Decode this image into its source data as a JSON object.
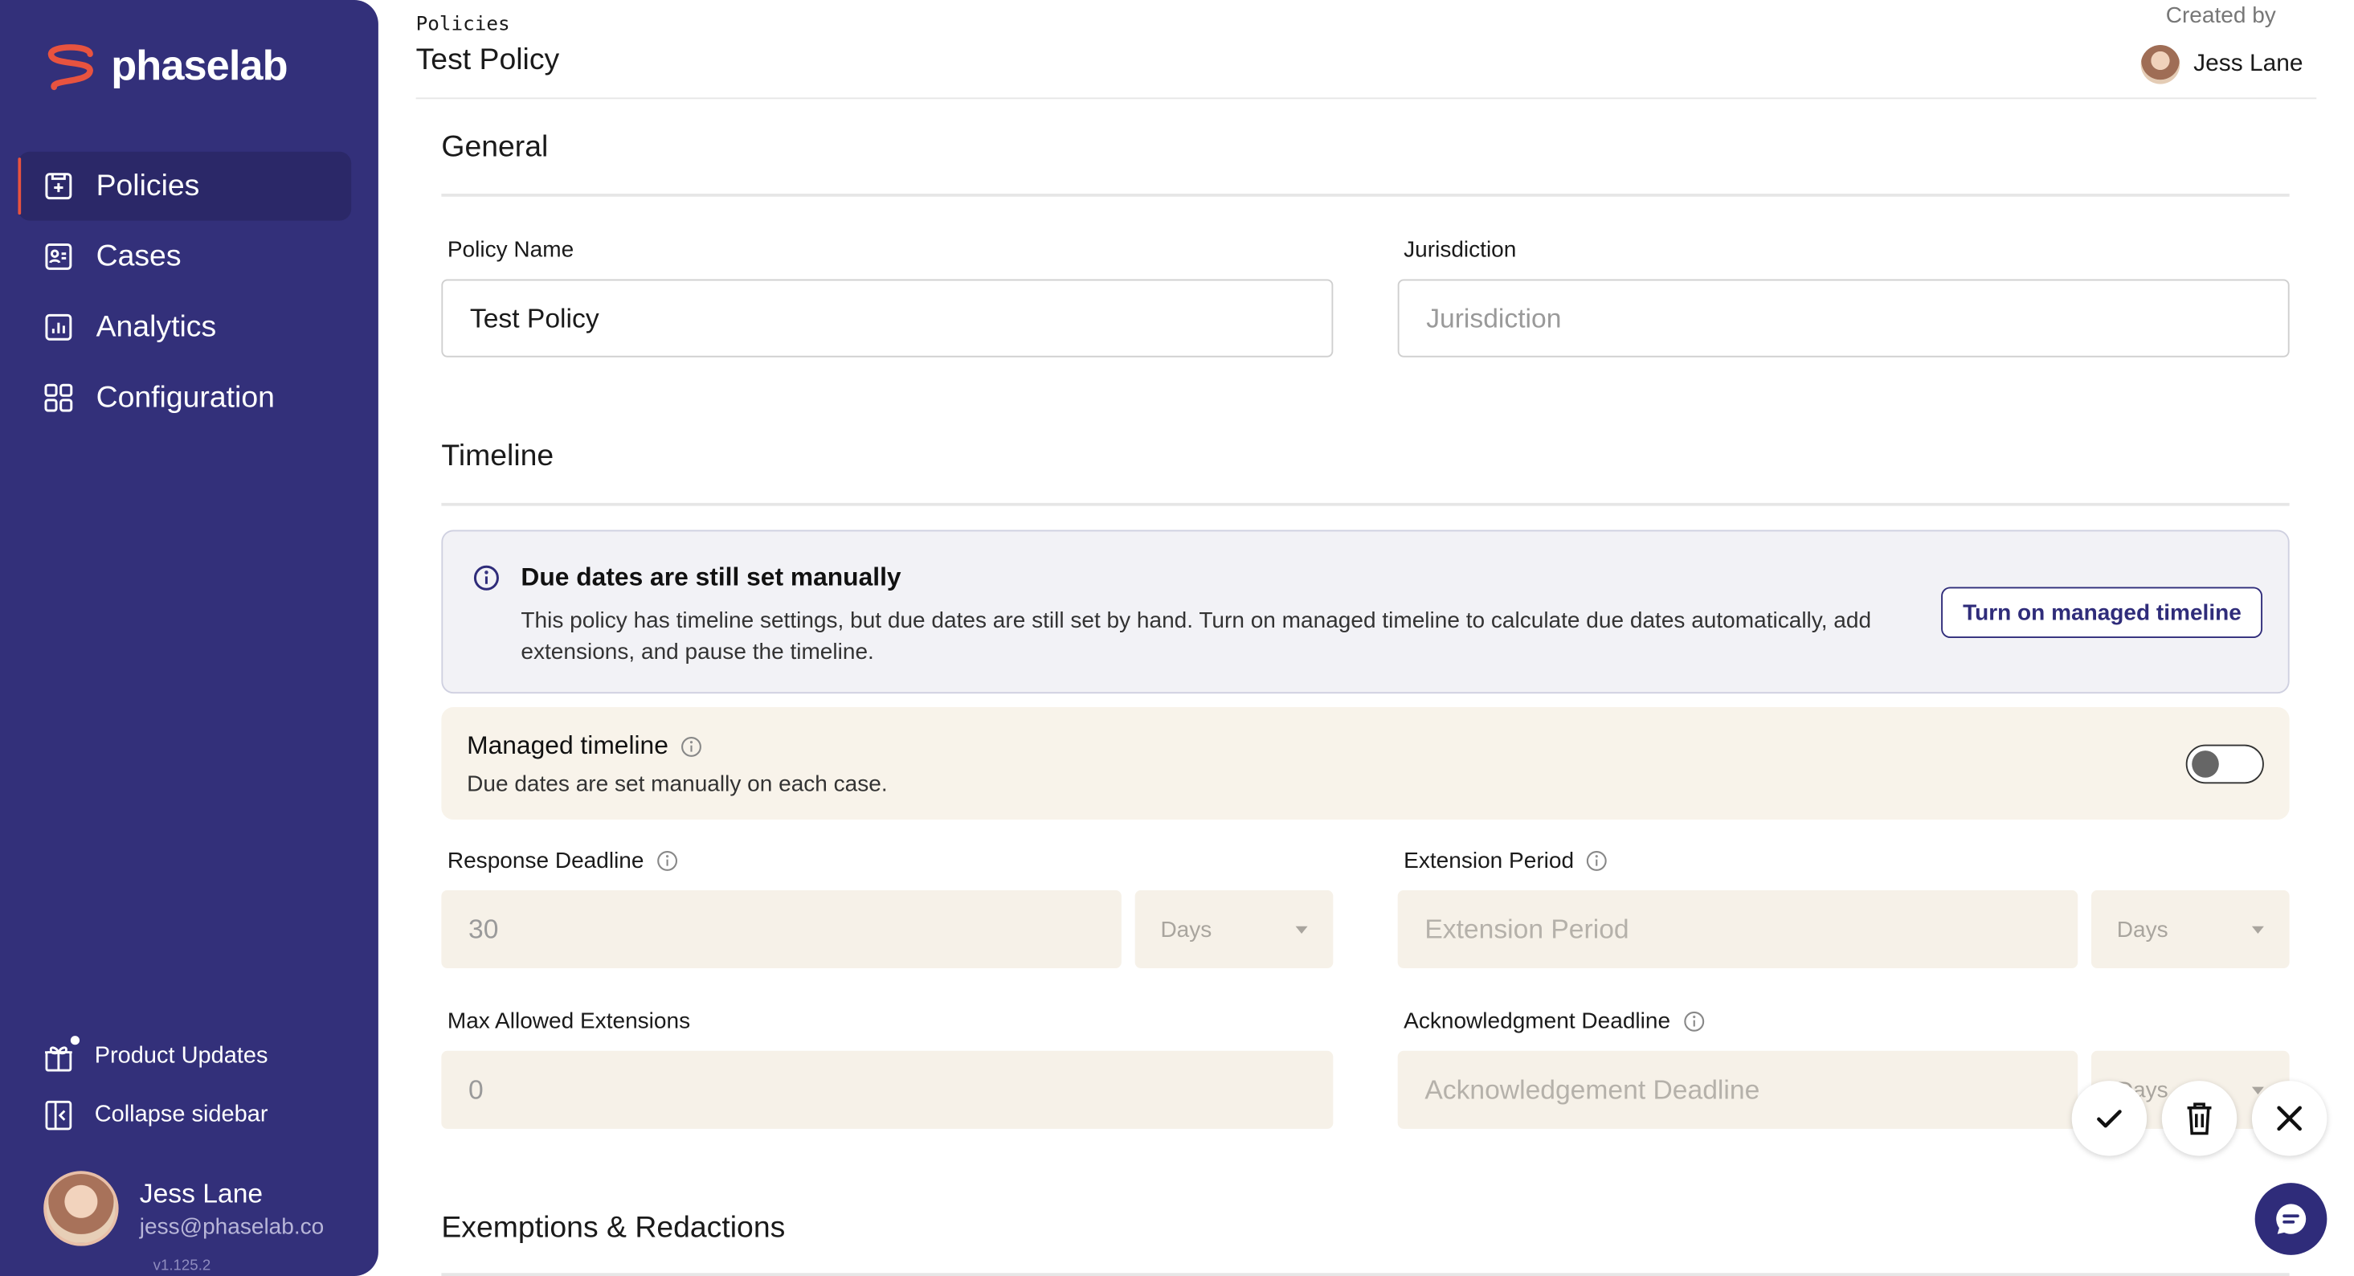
{
  "app": {
    "brand": "phaselab",
    "version": "v1.125.2"
  },
  "colors": {
    "sidebar": "#33307a",
    "accent": "#e8533f",
    "primary": "#2f2c7a",
    "disabled_field": "#f6f1e8"
  },
  "sidebar": {
    "items": [
      {
        "label": "Policies",
        "icon": "policy-doc-icon",
        "active": true
      },
      {
        "label": "Cases",
        "icon": "cases-card-icon",
        "active": false
      },
      {
        "label": "Analytics",
        "icon": "analytics-chart-icon",
        "active": false
      },
      {
        "label": "Configuration",
        "icon": "grid-config-icon",
        "active": false
      }
    ],
    "product_updates": "Product Updates",
    "collapse": "Collapse sidebar",
    "user": {
      "name": "Jess Lane",
      "email": "jess@phaselab.co"
    }
  },
  "header": {
    "breadcrumb": "Policies",
    "title": "Test Policy",
    "created_by_label": "Created by",
    "created_by_name": "Jess Lane"
  },
  "general": {
    "title": "General",
    "policy_name": {
      "label": "Policy Name",
      "value": "Test Policy"
    },
    "jurisdiction": {
      "label": "Jurisdiction",
      "value": "",
      "placeholder": "Jurisdiction"
    }
  },
  "timeline": {
    "title": "Timeline",
    "alert": {
      "title": "Due dates are still set manually",
      "body": "This policy has timeline settings, but due dates are still set by hand. Turn on managed timeline to calculate due dates automatically, add extensions, and pause the timeline.",
      "button": "Turn on managed timeline"
    },
    "managed": {
      "title": "Managed timeline",
      "description": "Due dates are set manually on each case.",
      "enabled": false
    },
    "response_deadline": {
      "label": "Response Deadline",
      "value": "30",
      "unit": "Days"
    },
    "extension_period": {
      "label": "Extension Period",
      "placeholder": "Extension Period",
      "unit": "Days"
    },
    "max_extensions": {
      "label": "Max Allowed Extensions",
      "value": "0"
    },
    "ack_deadline": {
      "label": "Acknowledgment Deadline",
      "placeholder": "Acknowledgement Deadline",
      "unit": "Days"
    }
  },
  "exemptions": {
    "title": "Exemptions & Redactions"
  }
}
